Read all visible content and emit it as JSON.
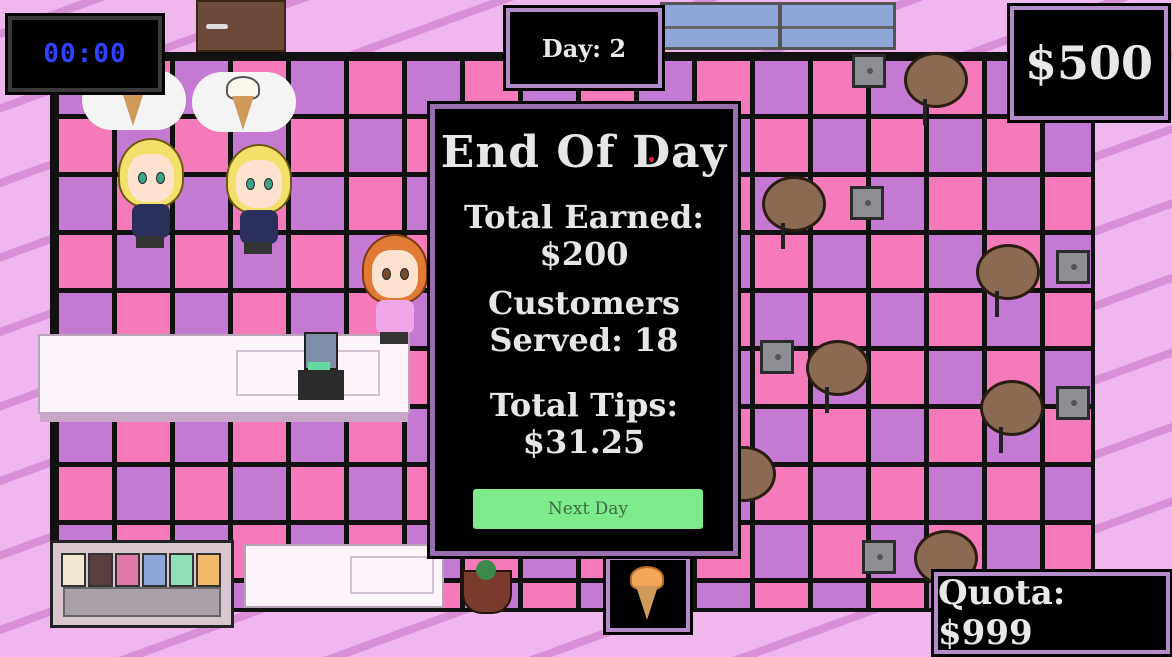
{
  "hud": {
    "timer": "00:00",
    "day": "Day: 2",
    "money": "$500",
    "quota": "Quota: $999"
  },
  "end_of_day": {
    "title": "End Of Day",
    "total_earned_label": "Total Earned:",
    "total_earned_value": "$200",
    "customers_label": "Customers",
    "served_label": "Served: 18",
    "tips_label": "Total Tips:",
    "tips_value": "$31.25",
    "next_day_button": "Next Day"
  },
  "flavors": [
    "#f2e8d2",
    "#5a3f3f",
    "#e07aaa",
    "#8fa6d9",
    "#8fe0b8",
    "#f3b96a"
  ],
  "colors": {
    "accent": "#b38cc9",
    "button_green": "#7deb8a",
    "timer_blue": "#2d43ff",
    "tile_pink": "#f57ab9",
    "tile_purple": "#c47ad3"
  }
}
